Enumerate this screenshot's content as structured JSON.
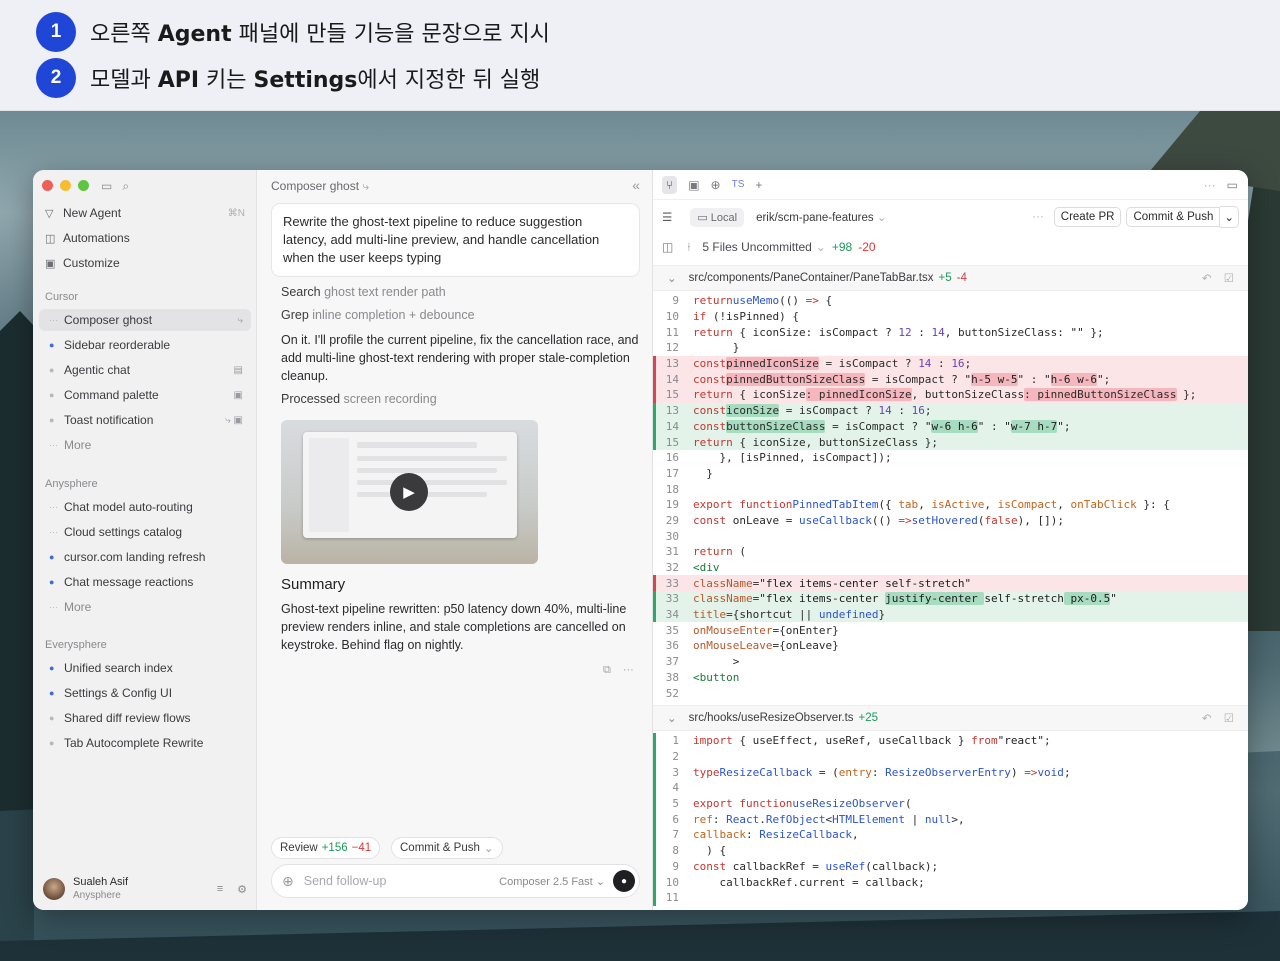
{
  "steps": [
    {
      "num": "1",
      "pre": "오른쪽 ",
      "bold": "Agent",
      "post": " 패널에 만들 기능을 문장으로 지시"
    },
    {
      "num": "2",
      "pre": "모델과 ",
      "bold": "API",
      "mid": " 키는 ",
      "bold2": "Settings",
      "post": "에서 지정한 뒤 실행"
    }
  ],
  "sidebar": {
    "nav": [
      {
        "icon": "filter-icon",
        "label": "New Agent",
        "kbd": "⌘N"
      },
      {
        "icon": "automation-icon",
        "label": "Automations"
      },
      {
        "icon": "customize-icon",
        "label": "Customize"
      }
    ],
    "sections": [
      {
        "title": "Cursor",
        "items": [
          {
            "label": "Composer ghost",
            "state": "working",
            "selected": true
          },
          {
            "label": "Sidebar reorderable",
            "state": "dot"
          },
          {
            "label": "Agentic chat",
            "state": "grey"
          },
          {
            "label": "Command palette",
            "state": "grey"
          },
          {
            "label": "Toast notification",
            "state": "grey"
          },
          {
            "label": "More",
            "state": "more"
          }
        ]
      },
      {
        "title": "Anysphere",
        "items": [
          {
            "label": "Chat model auto-routing",
            "state": "working"
          },
          {
            "label": "Cloud settings catalog",
            "state": "working"
          },
          {
            "label": "cursor.com landing refresh",
            "state": "dot"
          },
          {
            "label": "Chat message reactions",
            "state": "dot"
          },
          {
            "label": "More",
            "state": "more"
          }
        ]
      },
      {
        "title": "Everysphere",
        "items": [
          {
            "label": "Unified search index",
            "state": "dot"
          },
          {
            "label": "Settings & Config UI",
            "state": "dot"
          },
          {
            "label": "Shared diff review flows",
            "state": "grey"
          },
          {
            "label": "Tab Autocomplete Rewrite",
            "state": "grey"
          }
        ]
      }
    ],
    "user": {
      "name": "Sualeh Asif",
      "org": "Anysphere"
    }
  },
  "chat": {
    "title": "Composer ghost",
    "prompt": "Rewrite the ghost-text pipeline to reduce suggestion latency, add multi-line preview, and handle cancellation when the user keeps typing",
    "tool1": {
      "verb": "Search",
      "arg": "ghost text render path"
    },
    "tool2": {
      "verb": "Grep",
      "arg": "inline completion + debounce"
    },
    "reply": "On it. I'll profile the current pipeline, fix the cancellation race, and add multi-line ghost-text rendering with proper stale-completion cleanup.",
    "tool3": {
      "verb": "Processed",
      "arg": "screen recording"
    },
    "summary_title": "Summary",
    "summary": "Ghost-text pipeline rewritten: p50 latency down 40%, multi-line preview renders inline, and stale completions are cancelled on keystroke. Behind flag on nightly.",
    "review": {
      "label": "Review",
      "plus": "+156",
      "minus": "−41"
    },
    "commit": "Commit & Push",
    "placeholder": "Send follow-up",
    "model": "Composer 2.5 Fast"
  },
  "diff": {
    "local": "Local",
    "branch": "erik/scm-pane-features",
    "create_pr": "Create PR",
    "commit_push": "Commit & Push",
    "uncommitted": "5 Files Uncommitted",
    "plus": "+98",
    "minus": "-20",
    "file1": {
      "path": "src/components/PaneContainer/PaneTabBar.tsx",
      "plus": "+5",
      "minus": "-4"
    },
    "file2": {
      "path": "src/hooks/useResizeObserver.ts",
      "plus": "+25"
    }
  },
  "colors": {
    "accent": "#2046d8",
    "add": "#2fa86a",
    "del": "#d4474f"
  }
}
